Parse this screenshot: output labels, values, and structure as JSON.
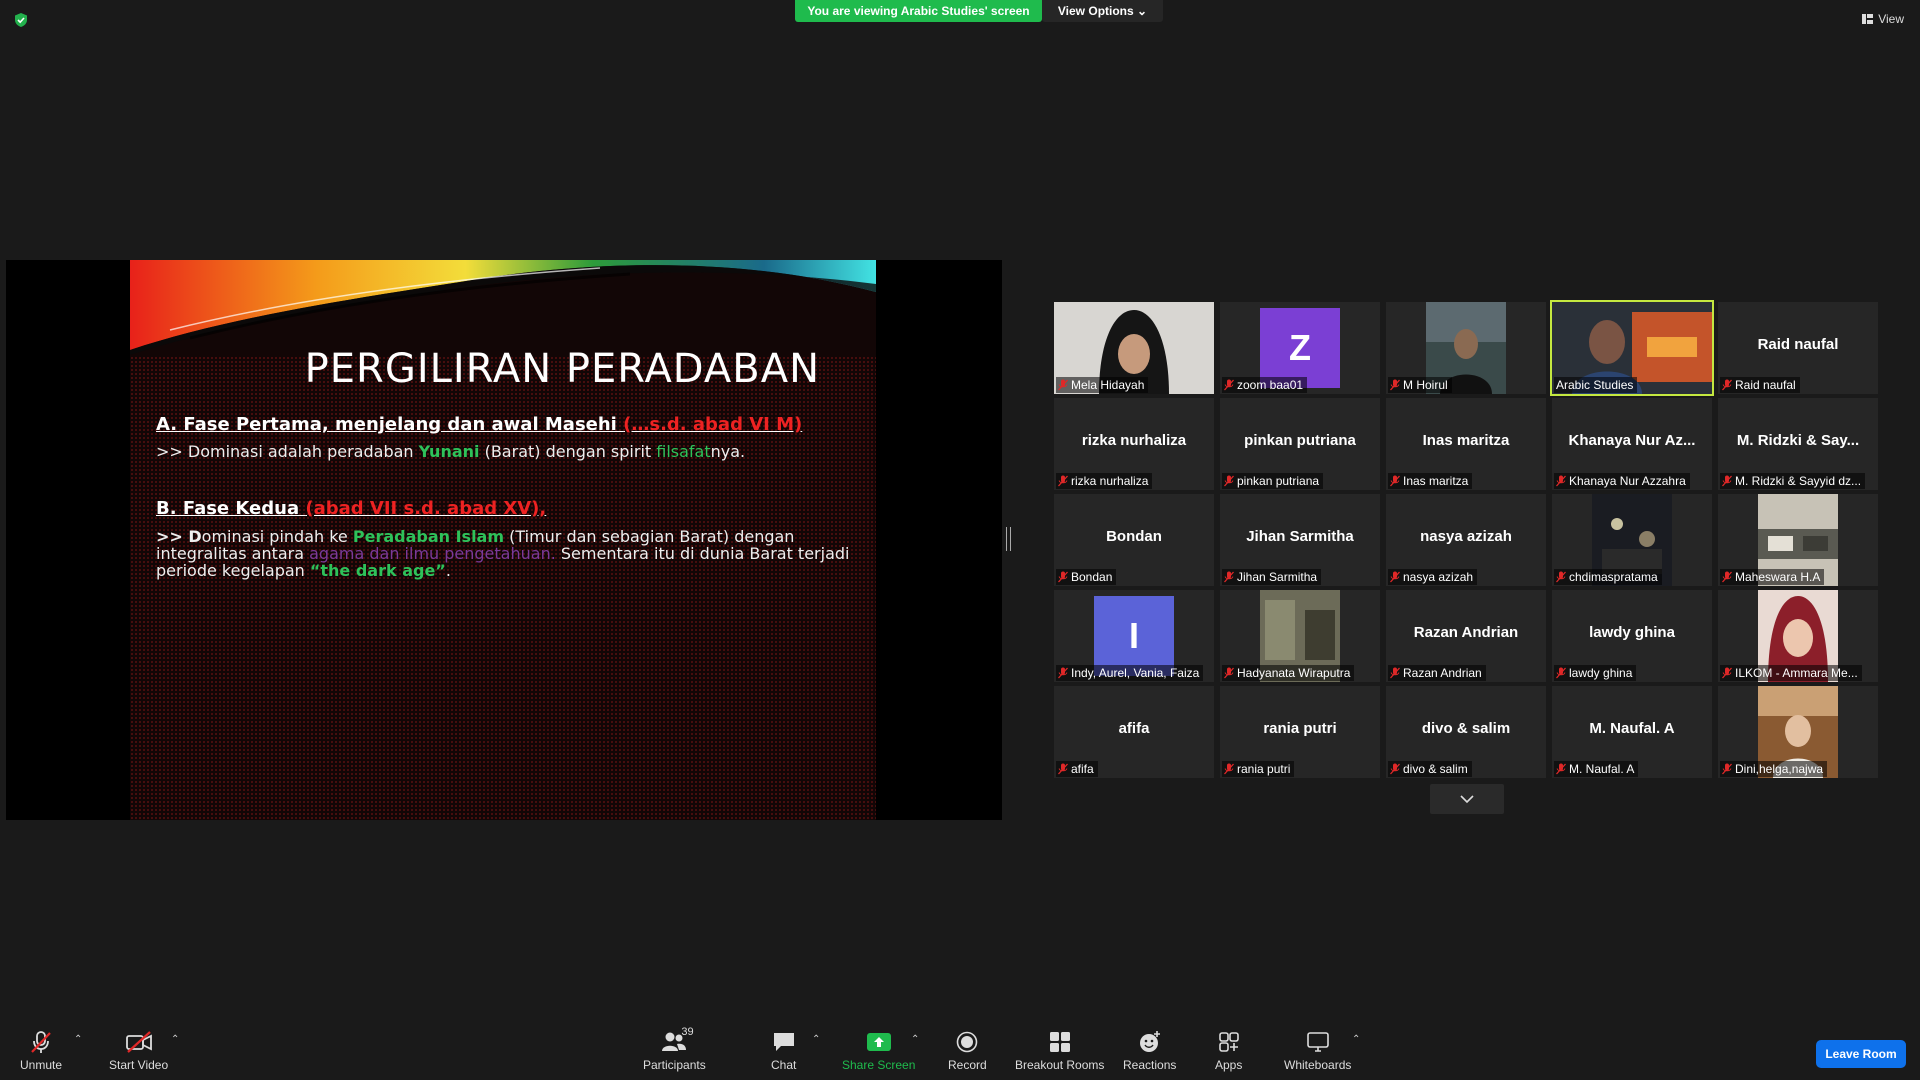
{
  "banner": {
    "viewing_text": "You are viewing Arabic Studies' screen",
    "view_options_label": "View Options",
    "view_label": "View"
  },
  "slide": {
    "title": "PERGILIRAN PERADABAN",
    "section_a": {
      "heading": "A. Fase Pertama,  menjelang dan awal Masehi ",
      "heading_red": "(…s.d. abad VI M)",
      "body_1": ">> Dominasi adalah peradaban ",
      "body_green": "Yunani",
      "body_2": " (Barat) dengan spirit ",
      "body_green_2": "filsafat",
      "body_3": "nya."
    },
    "section_b": {
      "heading": "B. Fase Kedua ",
      "heading_red": "(abad VII s.d. abad XV),",
      "body_1": "  >> D",
      "body_2": "ominasi pindah ke ",
      "body_green": "Peradaban Islam",
      "body_3": " (Timur dan sebagian Barat) dengan integralitas antara ",
      "body_purple": "agama dan ilmu pengetahuan.",
      "body_4": " Sementara itu di dunia Barat terjadi periode kegelapan  ",
      "body_green_2": "“the dark age”",
      "body_5": "."
    }
  },
  "participants": [
    {
      "label": "Mela Hidayah",
      "type": "photo",
      "photo": "mela"
    },
    {
      "label": "zoom baa01",
      "type": "letter",
      "letter": "Z",
      "color": "#7b3fd4"
    },
    {
      "label": "M Hoirul",
      "type": "photo",
      "photo": "hoirul"
    },
    {
      "label": "Arabic Studies",
      "type": "photo",
      "photo": "arabic",
      "active": true
    },
    {
      "label": "Raid naufal",
      "type": "name",
      "big": "Raid naufal"
    },
    {
      "label": "rizka nurhaliza",
      "type": "name",
      "big": "rizka nurhaliza"
    },
    {
      "label": "pinkan putriana",
      "type": "name",
      "big": "pinkan putriana"
    },
    {
      "label": "Inas maritza",
      "type": "name",
      "big": "Inas maritza"
    },
    {
      "label": "Khanaya Nur Azzahra",
      "type": "name",
      "big": "Khanaya Nur Az..."
    },
    {
      "label": "M. Ridzki & Sayyid dz...",
      "type": "name",
      "big": "M. Ridzki & Say..."
    },
    {
      "label": "Bondan",
      "type": "name",
      "big": "Bondan"
    },
    {
      "label": "Jihan Sarmitha",
      "type": "name",
      "big": "Jihan Sarmitha"
    },
    {
      "label": "nasya azizah",
      "type": "name",
      "big": "nasya azizah"
    },
    {
      "label": "chdimaspratama",
      "type": "photo",
      "photo": "chdimas"
    },
    {
      "label": "Maheswara H.A",
      "type": "photo",
      "photo": "maheswara"
    },
    {
      "label": "Indy, Aurel, Vania, Faiza",
      "type": "letter",
      "letter": "I",
      "color": "#5b63d8"
    },
    {
      "label": "Hadyanata Wiraputra",
      "type": "photo",
      "photo": "hadyanata"
    },
    {
      "label": "Razan Andrian",
      "type": "name",
      "big": "Razan Andrian"
    },
    {
      "label": "lawdy ghina",
      "type": "name",
      "big": "lawdy ghina"
    },
    {
      "label": "ILKOM - Ammara Me...",
      "type": "photo",
      "photo": "ammara"
    },
    {
      "label": "afifa",
      "type": "name",
      "big": "afifa"
    },
    {
      "label": "rania putri",
      "type": "name",
      "big": "rania putri"
    },
    {
      "label": "divo & salim",
      "type": "name",
      "big": "divo & salim"
    },
    {
      "label": "M. Naufal. A",
      "type": "name",
      "big": "M. Naufal. A"
    },
    {
      "label": "Dini,helga,najwa",
      "type": "photo",
      "photo": "dini"
    }
  ],
  "toolbar": {
    "unmute": "Unmute",
    "start_video": "Start Video",
    "participants": "Participants",
    "participant_count": "39",
    "chat": "Chat",
    "share_screen": "Share Screen",
    "record": "Record",
    "breakout_rooms": "Breakout Rooms",
    "reactions": "Reactions",
    "apps": "Apps",
    "whiteboards": "Whiteboards",
    "leave_room": "Leave Room"
  },
  "colors": {
    "share_green": "#1fbb4d",
    "leave_blue": "#0e71eb",
    "active_speaker": "#c4e840",
    "mute_red": "#e02828"
  }
}
